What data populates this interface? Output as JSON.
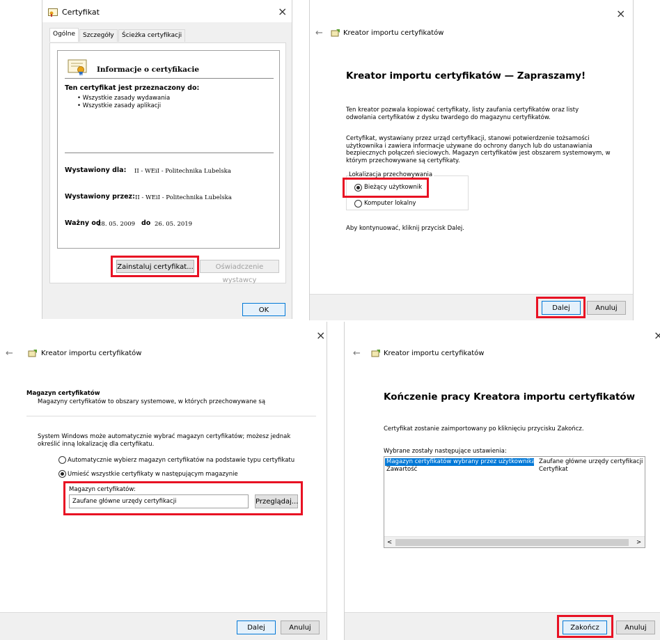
{
  "p1": {
    "title": "Certyfikat",
    "close": "×",
    "tabs": [
      "Ogólne",
      "Szczegóły",
      "Ścieżka certyfikacji"
    ],
    "info_heading": "Informacje o certyfikacie",
    "purpose_heading": "Ten certyfikat jest przeznaczony do:",
    "bullets": [
      "• Wszystkie zasady wydawania",
      "• Wszystkie zasady aplikacji"
    ],
    "issued_to_label": "Wystawiony dla:",
    "issued_to_value": "II - WEiI - Politechnika Lubelska",
    "issued_by_label": "Wystawiony przez:",
    "issued_by_value": "II - WEiI - Politechnika Lubelska",
    "valid_from_label": "Ważny od",
    "valid_from": "28. 05. 2009",
    "valid_to_label": "do",
    "valid_to": "26. 05. 2019",
    "install_button": "Zainstaluj certyfikat...",
    "statement_button": "Oświadczenie wystawcy",
    "ok_button": "OK"
  },
  "p2": {
    "close": "×",
    "back": "←",
    "wizard_title": "Kreator importu certyfikatów",
    "heading": "Kreator importu certyfikatów — Zapraszamy!",
    "para1": "Ten kreator pozwala kopiować certyfikaty, listy zaufania certyfikatów oraz listy odwołania certyfikatów z dysku twardego do magazynu certyfikatów.",
    "para2": "Certyfikat, wystawiany przez urząd certyfikacji, stanowi potwierdzenie tożsamości użytkownika i zawiera informacje używane do ochrony danych lub do ustanawiania bezpiecznych połączeń sieciowych. Magazyn certyfikatów jest obszarem systemowym, w którym przechowywane są certyfikaty.",
    "group_label": "Lokalizacja przechowywania",
    "option_current": "Bieżący użytkownik",
    "option_local": "Komputer lokalny",
    "continue_text": "Aby kontynuować, kliknij przycisk Dalej.",
    "next_button": "Dalej",
    "cancel_button": "Anuluj"
  },
  "p3": {
    "close": "×",
    "back": "←",
    "wizard_title": "Kreator importu certyfikatów",
    "section_title": "Magazyn certyfikatów",
    "section_desc": "Magazyny certyfikatów to obszary systemowe, w których przechowywane są",
    "para": "System Windows może automatycznie wybrać magazyn certyfikatów; możesz jednak określić inną lokalizację dla certyfikatu.",
    "option_auto": "Automatycznie wybierz magazyn certyfikatów na podstawie typu certyfikatu",
    "option_manual": "Umieść wszystkie certyfikaty w następującym magazynie",
    "store_label": "Magazyn certyfikatów:",
    "store_value": "Zaufane główne urzędy certyfikacji",
    "browse_button": "Przeglądaj...",
    "next_button": "Dalej",
    "cancel_button": "Anuluj"
  },
  "p4": {
    "close": "×",
    "back": "←",
    "wizard_title": "Kreator importu certyfikatów",
    "heading": "Kończenie pracy Kreatora importu certyfikatów",
    "para": "Certyfikat zostanie zaimportowany po kliknięciu przycisku Zakończ.",
    "settings_label": "Wybrane zostały następujące ustawienia:",
    "rows": [
      {
        "key": "Magazyn certyfikatów wybrany przez użytkownika",
        "value": "Zaufane główne urzędy certyfikacji"
      },
      {
        "key": "Zawartość",
        "value": "Certyfikat"
      }
    ],
    "scroll_left": "<",
    "scroll_right": ">",
    "finish_button": "Zakończ",
    "cancel_button": "Anuluj"
  },
  "colors": {
    "highlight_red": "#e81123",
    "selection_blue": "#0078d7",
    "footer_gray": "#f0f0f0"
  }
}
